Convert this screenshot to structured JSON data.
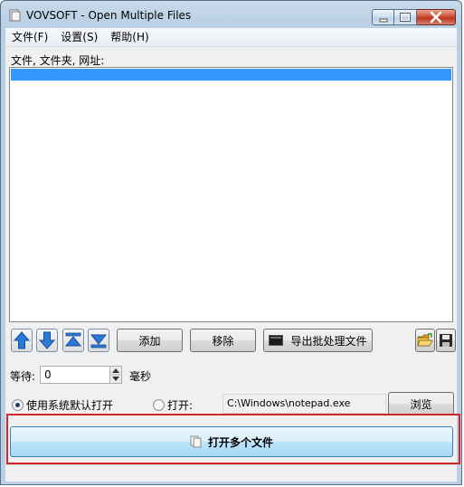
{
  "window": {
    "title": "VOVSOFT - Open Multiple Files"
  },
  "menu": {
    "items": [
      "文件(F)",
      "设置(S)",
      "帮助(H)"
    ]
  },
  "files_label": "文件, 文件夹, 网址:",
  "toolbar": {
    "add_label": "添加",
    "remove_label": "移除",
    "export_label": "导出批处理文件"
  },
  "wait": {
    "label": "等待:",
    "value": "0",
    "unit": "毫秒"
  },
  "open_with": {
    "default_label": "使用系统默认打开",
    "custom_label": "打开:",
    "path": "C:\\Windows\\notepad.exe",
    "browse_label": "浏览",
    "selected": "default"
  },
  "open_multi_label": "打开多个文件",
  "colors": {
    "selection": "#3399ff",
    "highlight": "#d3252a",
    "arrow_blue": "#2b7ad8"
  }
}
